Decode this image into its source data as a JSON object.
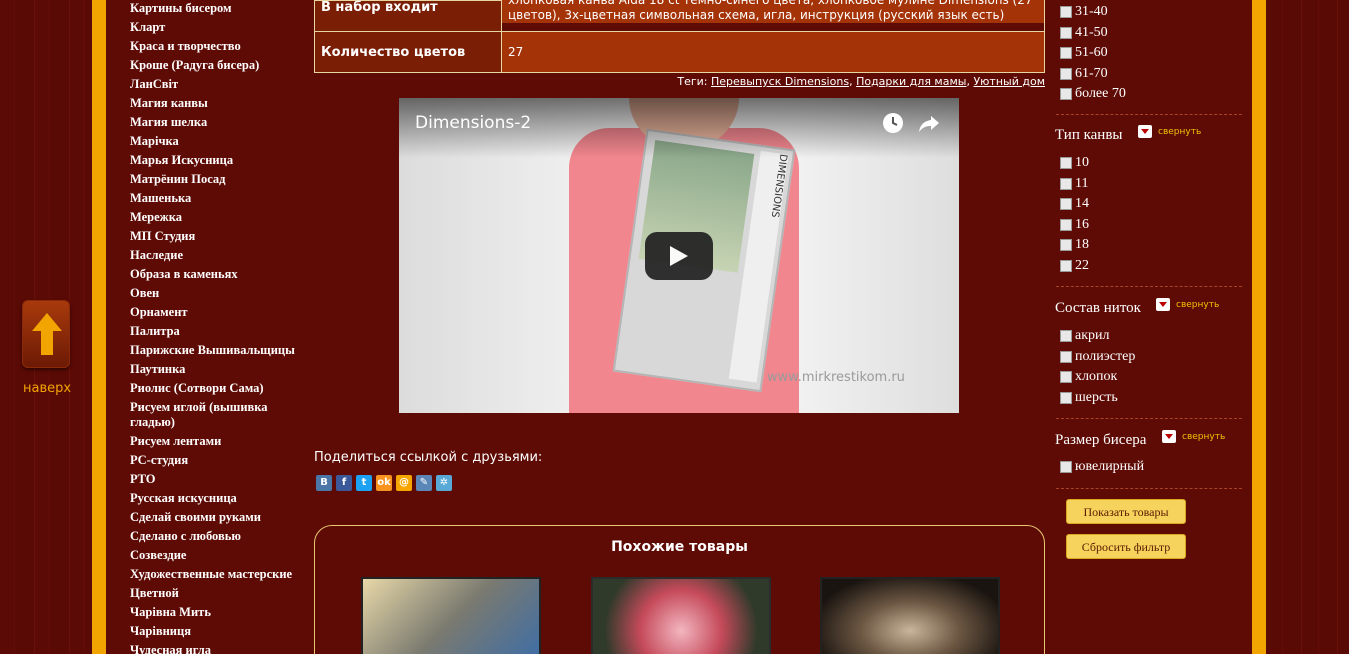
{
  "to_top_label": "наверх",
  "brands": [
    "Картины бисером",
    "Кларт",
    "Краса и творчество",
    "Кроше (Радуга бисера)",
    "ЛанСвіт",
    "Магия канвы",
    "Магия шелка",
    "Марічка",
    "Марья Искусница",
    "Матрёнин Посад",
    "Машенька",
    "Мережка",
    "МП Студия",
    "Наследие",
    "Образа в каменьях",
    "Овен",
    "Орнамент",
    "Палитра",
    "Парижские Вышивальщицы",
    "Паутинка",
    "Риолис (Сотвори Сама)",
    "Рисуем иглой (вышивка гладью)",
    "Рисуем лентами",
    "PC-студия",
    "PTO",
    "Русская искусница",
    "Сделай своими руками",
    "Сделано с любовью",
    "Созвездие",
    "Художественные мастерские",
    "Цветной",
    "Чарівна Мить",
    "Чарівниця",
    "Чудесная игла"
  ],
  "specs": [
    {
      "label": "В набор входит",
      "value": "хлопковая канва Aida 18 ct темно-синего цвета, хлопковое мулине Dimensions (27 цветов), 3х-цветная символьная схема, игла, инструкция (русский язык есть)"
    },
    {
      "label": "Количество цветов",
      "value": "27"
    }
  ],
  "tags": {
    "label": "Теги:",
    "items": [
      "Перевыпуск Dimensions",
      "Подарки для мамы",
      "Уютный дом"
    ]
  },
  "video": {
    "title": "Dimensions-2",
    "box_brand": "DIMENSIONS",
    "watermark": "www.mirkrestikom.ru"
  },
  "share": {
    "label": "Поделиться ссылкой с друзьями:",
    "icons": [
      {
        "name": "vk-icon",
        "glyph": "В",
        "color": "#4a76a8"
      },
      {
        "name": "facebook-icon",
        "glyph": "f",
        "color": "#3b5998"
      },
      {
        "name": "twitter-icon",
        "glyph": "t",
        "color": "#1da1f2"
      },
      {
        "name": "odnoklassniki-icon",
        "glyph": "ok",
        "color": "#f7931e"
      },
      {
        "name": "mailru-icon",
        "glyph": "@",
        "color": "#f7a600"
      },
      {
        "name": "livejournal-icon",
        "glyph": "✎",
        "color": "#5a86b8"
      },
      {
        "name": "liveinternet-icon",
        "glyph": "✲",
        "color": "#58a9d6"
      }
    ]
  },
  "similar": {
    "title": "Похожие товары"
  },
  "filter": {
    "age_options": [
      "31-40",
      "41-50",
      "51-60",
      "61-70",
      "более 70"
    ],
    "canvas_type": {
      "title": "Тип канвы",
      "collapse": "свернуть",
      "options": [
        "10",
        "11",
        "14",
        "16",
        "18",
        "22"
      ]
    },
    "thread": {
      "title": "Состав ниток",
      "collapse": "свернуть",
      "options": [
        "акрил",
        "полиэстер",
        "хлопок",
        "шерсть"
      ]
    },
    "bead": {
      "title": "Размер бисера",
      "collapse": "свернуть",
      "options": [
        "ювелирный"
      ]
    },
    "show_button": "Показать товары",
    "reset_button": "Сбросить фильтр"
  }
}
